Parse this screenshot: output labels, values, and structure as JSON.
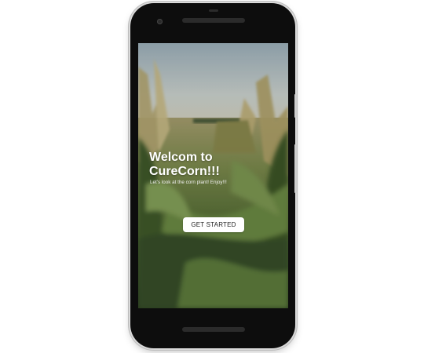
{
  "app": {
    "welcome_title": "Welcom to CureCorn!!!",
    "welcome_subtitle": "Let's look at the corn plant! Enjoy!!!",
    "cta_label": "GET STARTED"
  },
  "background": {
    "image": "corn-field-photo",
    "sky_color": "#c9d2d3",
    "foliage_color": "#5f7a3e"
  },
  "device": {
    "frame_color": "#0d0d0d"
  }
}
